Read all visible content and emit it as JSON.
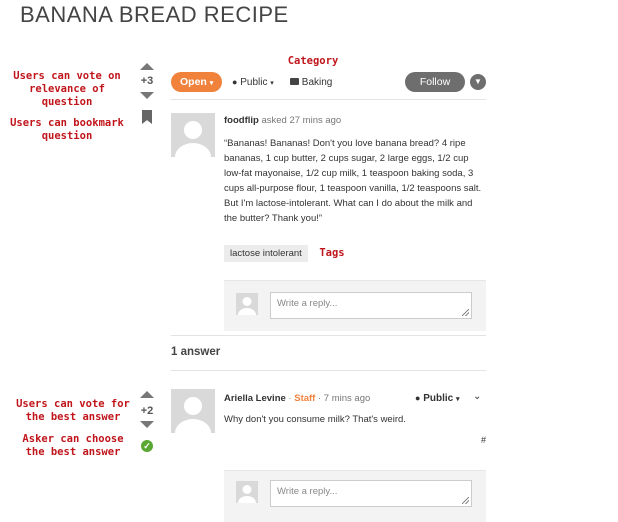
{
  "page_title": "BANANA BREAD RECIPE",
  "annotations": {
    "category": "Category",
    "vote_question": [
      "Users can vote on",
      "relevance of question"
    ],
    "bookmark": [
      "Users can bookmark",
      "question"
    ],
    "tags": "Tags",
    "vote_answer": [
      "Users can vote for",
      "the best answer"
    ],
    "choose_best": [
      "Asker can choose",
      "the best answer"
    ]
  },
  "question": {
    "vote_count": "+3",
    "status_button": "Open",
    "visibility": "Public",
    "category": "Baking",
    "follow_button": "Follow",
    "author": "foodflip",
    "asked_meta": "asked 27 mins ago",
    "body": "“Bananas! Bananas! Don't you love banana bread?   4 ripe bananas, 1 cup butter, 2 cups sugar, 2 large eggs, 1/2 cup low-fat mayonaise, 1/2 cup milk, 1 teaspoon baking soda, 3 cups all-purpose flour, 1 teaspoon vanilla, 1/2 teaspoons salt. But I'm lactose-intolerant. What can I do about the milk and the butter? Thank you!”",
    "tags": [
      "lactose intolerant"
    ],
    "reply_placeholder": "Write a reply..."
  },
  "answers_heading": "1 answer",
  "answer": {
    "vote_count": "+2",
    "author": "Ariella Levine",
    "separator": "·",
    "role": "Staff",
    "time": "· 7 mins ago",
    "visibility": "Public",
    "body": "Why don't you consume milk? That's weird.",
    "permalink": "#",
    "reply_placeholder": "Write a reply..."
  },
  "colors": {
    "accent": "#f0823c",
    "annotation": "#c0151b",
    "follow": "#6e6e6e",
    "check": "#5aa833"
  }
}
